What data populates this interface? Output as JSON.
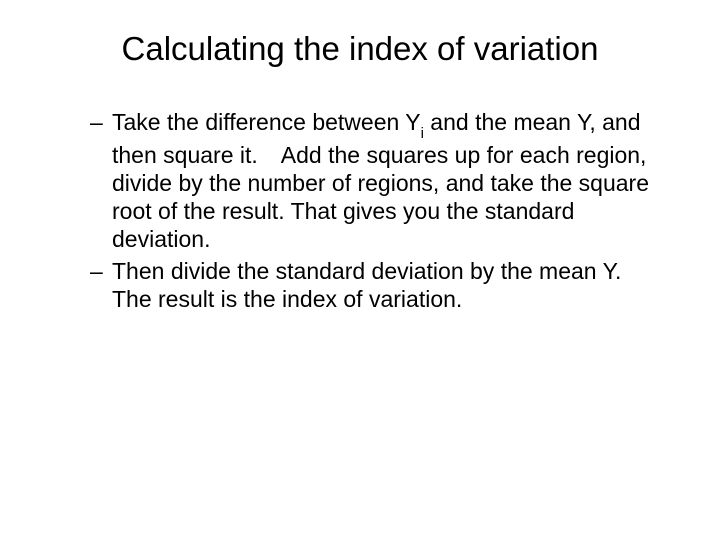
{
  "title": "Calculating the index of variation",
  "bullets": [
    {
      "pre": "Take the difference between Y",
      "sub": "i",
      "post_html": " and the mean Y, and then square it. Add the squares up for each region, divide by the number of regions, and take the square root of the result. That gives you the standard deviation."
    },
    {
      "text": "Then divide the standard deviation by the mean Y. The result is the index of variation."
    }
  ]
}
